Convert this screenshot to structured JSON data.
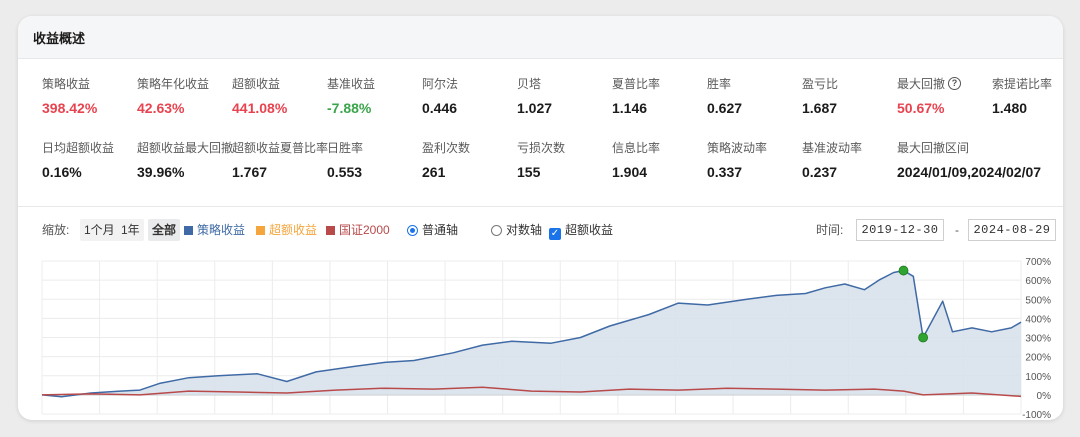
{
  "panel": {
    "title": "收益概述"
  },
  "metrics_row1": [
    {
      "label": "策略收益",
      "value": "398.42%",
      "tone": "red"
    },
    {
      "label": "策略年化收益",
      "value": "42.63%",
      "tone": "red"
    },
    {
      "label": "超额收益",
      "value": "441.08%",
      "tone": "red"
    },
    {
      "label": "基准收益",
      "value": "-7.88%",
      "tone": "green"
    },
    {
      "label": "阿尔法",
      "value": "0.446",
      "tone": "normal"
    },
    {
      "label": "贝塔",
      "value": "1.027",
      "tone": "normal"
    },
    {
      "label": "夏普比率",
      "value": "1.146",
      "tone": "normal"
    },
    {
      "label": "胜率",
      "value": "0.627",
      "tone": "normal"
    },
    {
      "label": "盈亏比",
      "value": "1.687",
      "tone": "normal"
    },
    {
      "label": "最大回撤",
      "value": "50.67%",
      "tone": "red",
      "help": "?"
    },
    {
      "label": "索提诺比率",
      "value": "1.480",
      "tone": "normal"
    }
  ],
  "metrics_row2": [
    {
      "label": "日均超额收益",
      "value": "0.16%"
    },
    {
      "label": "超额收益最大回撤",
      "value": "39.96%"
    },
    {
      "label": "超额收益夏普比率",
      "value": "1.767"
    },
    {
      "label": "日胜率",
      "value": "0.553"
    },
    {
      "label": "盈利次数",
      "value": "261"
    },
    {
      "label": "亏损次数",
      "value": "155"
    },
    {
      "label": "信息比率",
      "value": "1.904"
    },
    {
      "label": "策略波动率",
      "value": "0.337"
    },
    {
      "label": "基准波动率",
      "value": "0.237"
    },
    {
      "label": "最大回撤区间",
      "value": "2024/01/09,2024/02/07"
    }
  ],
  "toolbar": {
    "zoom_label": "缩放:",
    "zoom_options": [
      "1个月",
      "1年",
      "全部"
    ],
    "legend": [
      {
        "label": "策略收益",
        "color": "#3f6aa5"
      },
      {
        "label": "超额收益",
        "color": "#f4a53c"
      },
      {
        "label": "国证2000",
        "color": "#b84a4a"
      }
    ],
    "axis_normal": "普通轴",
    "axis_log": "对数轴",
    "excess_checkbox": "超额收益",
    "time_label": "时间:",
    "date_from": "2019-12-30",
    "date_sep": "-",
    "date_to": "2024-08-29"
  },
  "chart_data": {
    "type": "area",
    "x_range": [
      "2019-12-30",
      "2024-08-29"
    ],
    "ylim": [
      -100,
      700
    ],
    "y_ticks": [
      "700%",
      "600%",
      "500%",
      "400%",
      "300%",
      "200%",
      "100%",
      "0%",
      "-100%"
    ],
    "y_tick_values": [
      700,
      600,
      500,
      400,
      300,
      200,
      100,
      0,
      -100
    ],
    "grid": true,
    "series": [
      {
        "name": "策略收益",
        "color": "#3f6aa5",
        "fill": "#d8e1ec",
        "x_frac": [
          0,
          0.02,
          0.05,
          0.08,
          0.1,
          0.12,
          0.15,
          0.18,
          0.22,
          0.25,
          0.28,
          0.32,
          0.35,
          0.38,
          0.42,
          0.45,
          0.48,
          0.52,
          0.55,
          0.58,
          0.62,
          0.65,
          0.68,
          0.72,
          0.75,
          0.78,
          0.8,
          0.82,
          0.84,
          0.855,
          0.87,
          0.88,
          0.89,
          0.9,
          0.92,
          0.93,
          0.95,
          0.97,
          0.99,
          1.0
        ],
        "values": [
          0,
          -10,
          10,
          20,
          25,
          60,
          90,
          100,
          110,
          70,
          120,
          150,
          170,
          180,
          220,
          260,
          280,
          270,
          300,
          360,
          420,
          480,
          470,
          500,
          520,
          530,
          560,
          580,
          550,
          600,
          640,
          650,
          620,
          300,
          490,
          330,
          350,
          330,
          350,
          380
        ]
      },
      {
        "name": "国证2000",
        "color": "#b84a4a",
        "x_frac": [
          0,
          0.05,
          0.1,
          0.15,
          0.2,
          0.25,
          0.3,
          0.35,
          0.4,
          0.45,
          0.5,
          0.55,
          0.6,
          0.65,
          0.7,
          0.75,
          0.8,
          0.85,
          0.88,
          0.9,
          0.95,
          1.0
        ],
        "values": [
          0,
          5,
          0,
          20,
          15,
          10,
          25,
          35,
          30,
          40,
          20,
          15,
          30,
          25,
          35,
          30,
          25,
          30,
          20,
          0,
          10,
          -8
        ]
      }
    ],
    "markers": [
      {
        "series": "策略收益",
        "x_frac": 0.88,
        "value": 650,
        "color": "#2fa52f"
      },
      {
        "series": "策略收益",
        "x_frac": 0.9,
        "value": 300,
        "color": "#2fa52f"
      }
    ]
  }
}
